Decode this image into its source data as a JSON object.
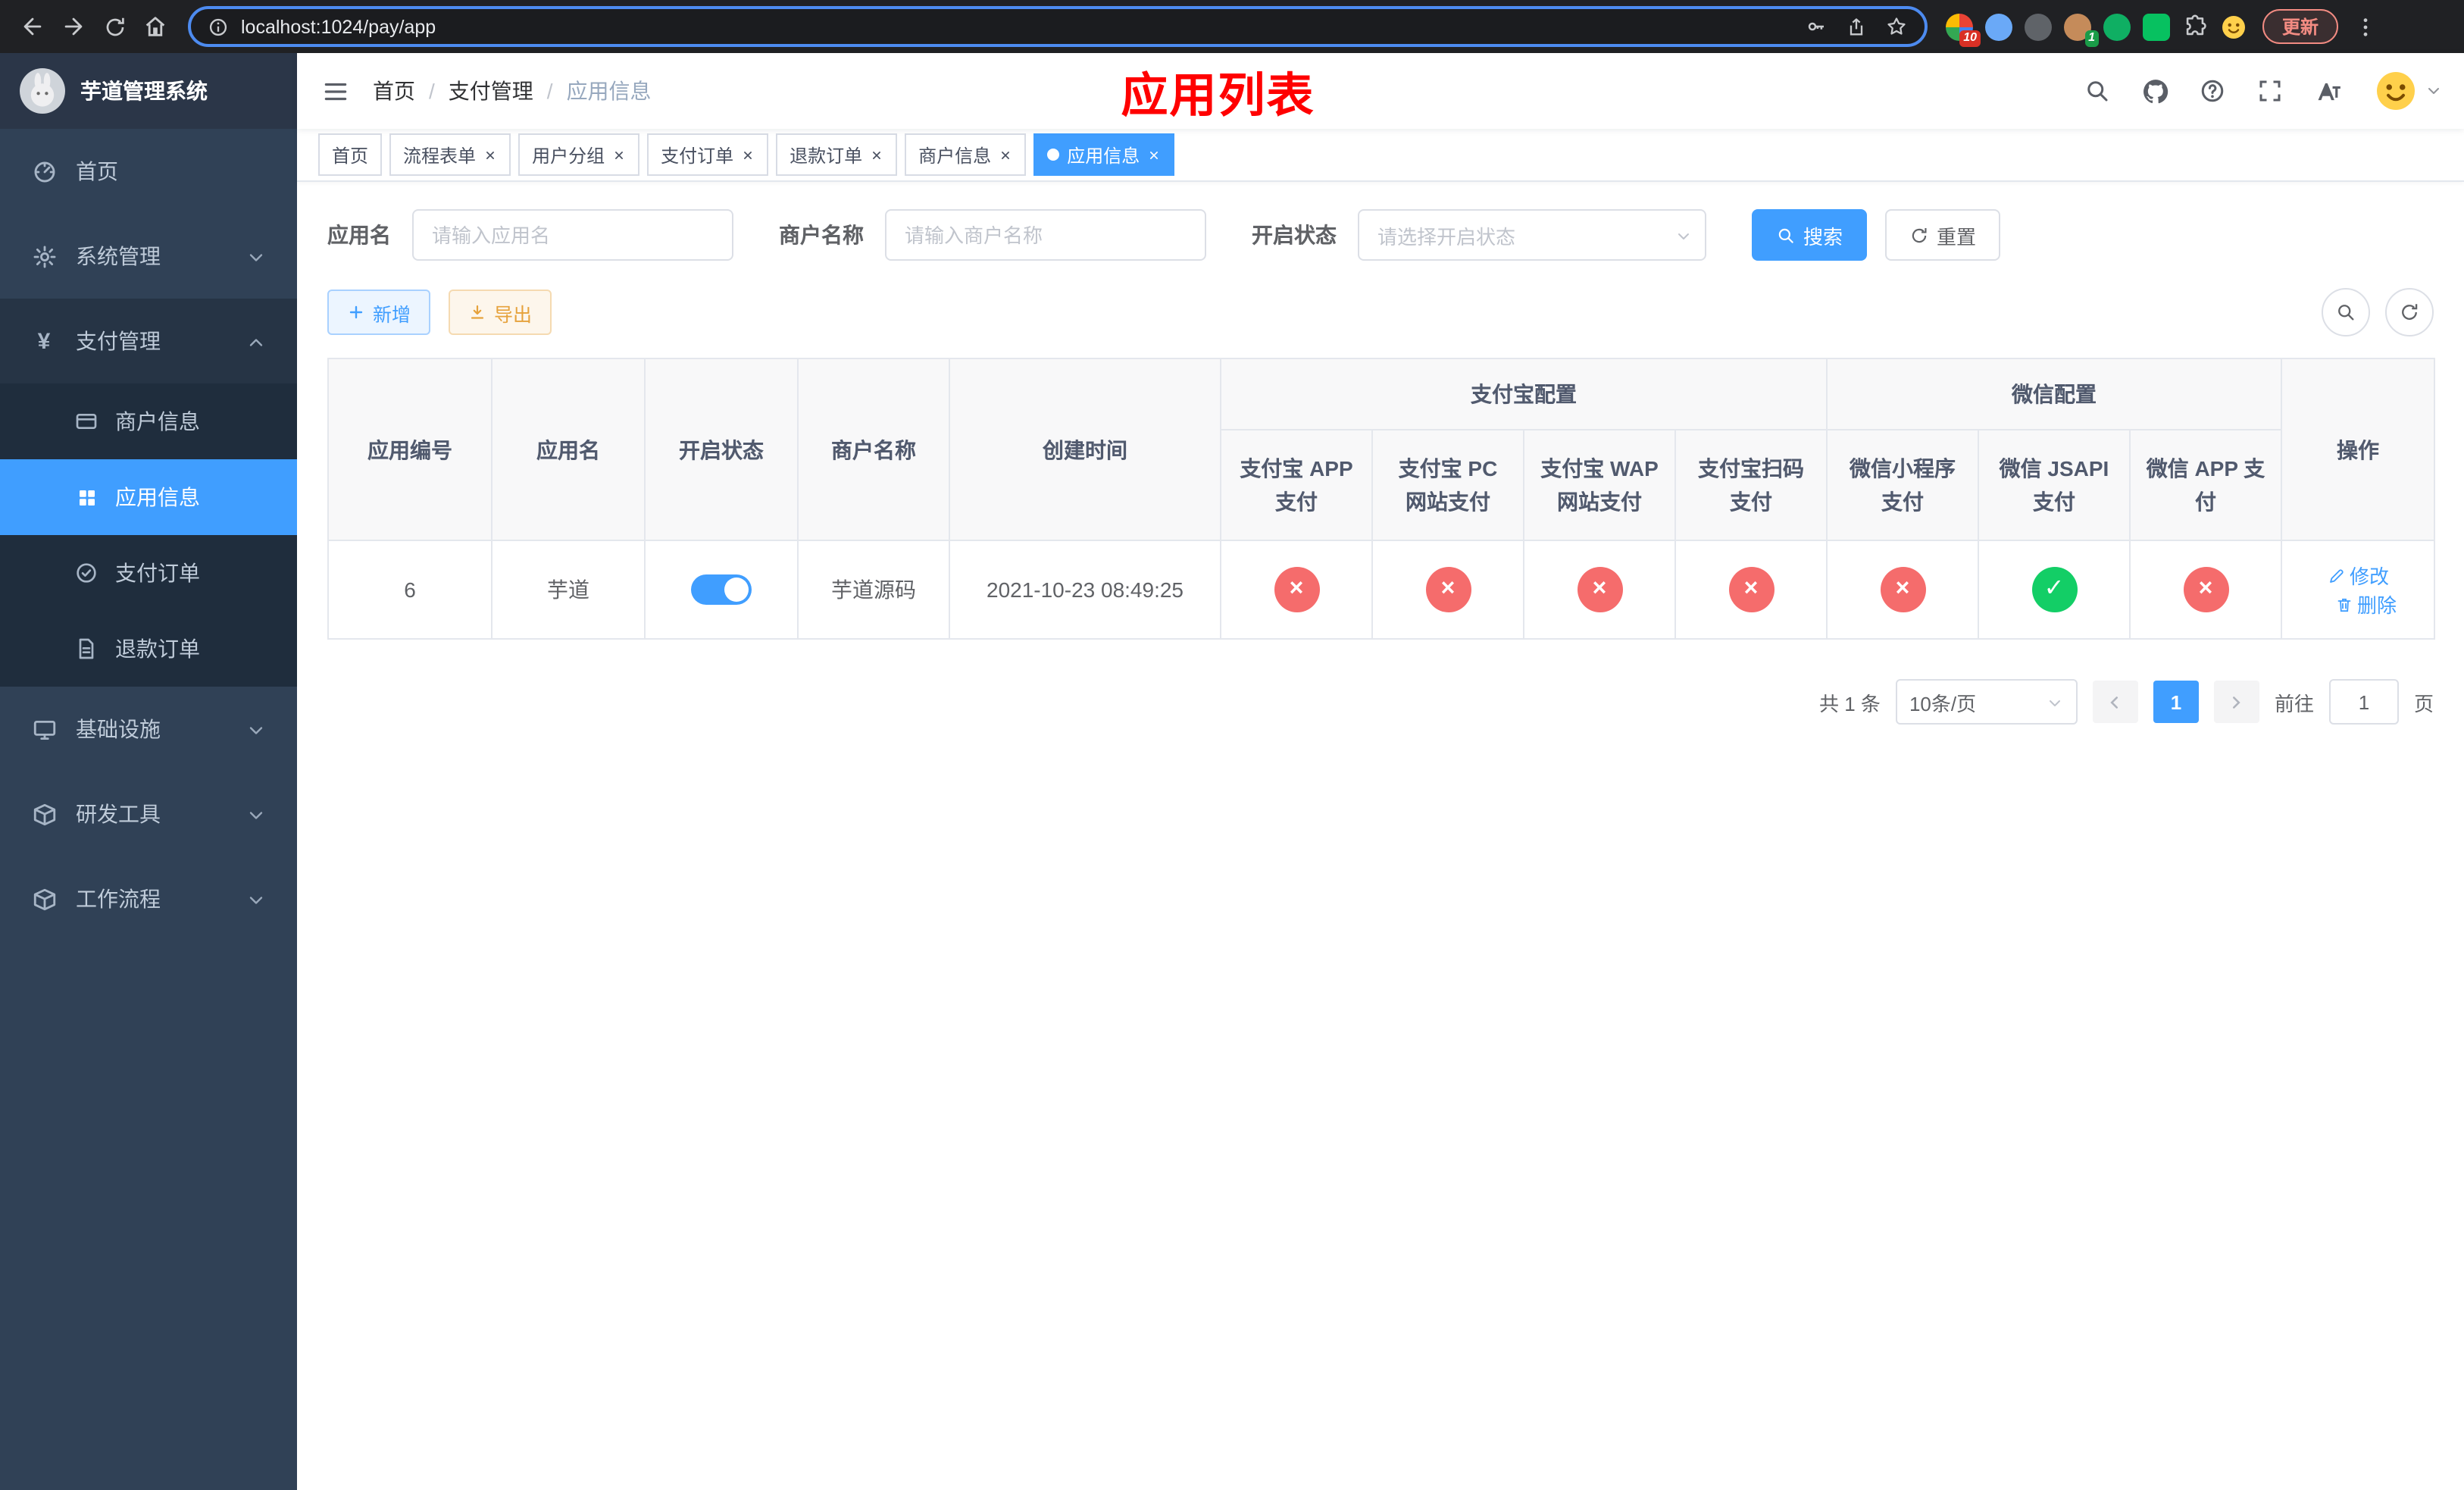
{
  "colors": {
    "accent": "#409eff",
    "success": "#13ce66",
    "danger": "#f56c6c",
    "warning": "#e6a23c",
    "page_title_red": "#ff0000",
    "sidebar_bg": "#304156",
    "submenu_bg": "#1f2d3d"
  },
  "browser": {
    "url": "localhost:1024/pay/app",
    "update_label": "更新",
    "ext_badge_1": "10",
    "ext_badge_2": "1"
  },
  "sidebar": {
    "logo_title": "芋道管理系统",
    "menu": [
      {
        "label": "首页",
        "icon": "dashboard-icon"
      },
      {
        "label": "系统管理",
        "icon": "gear-icon"
      },
      {
        "label": "支付管理",
        "icon": "yen-icon",
        "children": [
          {
            "label": "商户信息",
            "icon": "card-icon"
          },
          {
            "label": "应用信息",
            "icon": "grid-icon",
            "active": true
          },
          {
            "label": "支付订单",
            "icon": "order-icon"
          },
          {
            "label": "退款订单",
            "icon": "document-icon"
          }
        ]
      },
      {
        "label": "基础设施",
        "icon": "monitor-icon"
      },
      {
        "label": "研发工具",
        "icon": "box-icon"
      },
      {
        "label": "工作流程",
        "icon": "box-icon"
      }
    ]
  },
  "navbar": {
    "breadcrumb": [
      "首页",
      "支付管理",
      "应用信息"
    ],
    "separator": "/",
    "page_title": "应用列表"
  },
  "tabs": [
    {
      "label": "首页",
      "closable": false
    },
    {
      "label": "流程表单",
      "closable": true
    },
    {
      "label": "用户分组",
      "closable": true
    },
    {
      "label": "支付订单",
      "closable": true
    },
    {
      "label": "退款订单",
      "closable": true
    },
    {
      "label": "商户信息",
      "closable": true
    },
    {
      "label": "应用信息",
      "closable": true,
      "active": true
    }
  ],
  "filters": {
    "app_name_label": "应用名",
    "app_name_placeholder": "请输入应用名",
    "merchant_label": "商户名称",
    "merchant_placeholder": "请输入商户名称",
    "status_label": "开启状态",
    "status_placeholder": "请选择开启状态",
    "search_label": "搜索",
    "reset_label": "重置"
  },
  "toolbar": {
    "add_label": "新增",
    "export_label": "导出"
  },
  "table": {
    "col_id": "应用编号",
    "col_name": "应用名",
    "col_status": "开启状态",
    "col_merchant": "商户名称",
    "col_created": "创建时间",
    "col_ops": "操作",
    "group_alipay": "支付宝配置",
    "group_wechat": "微信配置",
    "sub_cols": [
      "支付宝 APP 支付",
      "支付宝 PC 网站支付",
      "支付宝 WAP 网站支付",
      "支付宝扫码支付",
      "微信小程序支付",
      "微信 JSAPI 支付",
      "微信 APP 支付"
    ],
    "rows": [
      {
        "id": "6",
        "name": "芋道",
        "enabled": true,
        "merchant": "芋道源码",
        "created": "2021-10-23 08:49:25",
        "alipay_app": false,
        "alipay_pc": false,
        "alipay_wap": false,
        "alipay_qr": false,
        "wechat_mini": false,
        "wechat_jsapi": true,
        "wechat_app": false,
        "edit_label": "修改",
        "delete_label": "删除"
      }
    ]
  },
  "pagination": {
    "total": "共 1 条",
    "page_size": "10条/页",
    "page": "1",
    "goto": "前往",
    "goto_value": "1",
    "unit": "页"
  }
}
